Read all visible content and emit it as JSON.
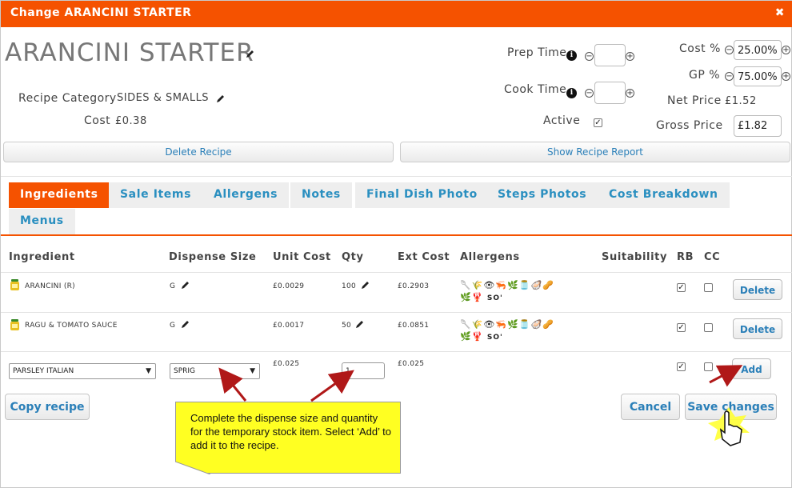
{
  "dialog": {
    "title": "Change ARANCINI STARTER",
    "close_glyph": "✖"
  },
  "recipe": {
    "name": "ARANCINI STARTER",
    "category_label": "Recipe Category",
    "category_value": "SIDES & SMALLS",
    "cost_label": "Cost",
    "cost_value": "£0.38"
  },
  "timing": {
    "prep_label": "Prep Time",
    "prep_value": "",
    "cook_label": "Cook Time",
    "cook_value": "",
    "active_label": "Active",
    "active_checked": true
  },
  "pricing": {
    "cost_pct_label": "Cost %",
    "cost_pct_value": "25.00%",
    "gp_pct_label": "GP %",
    "gp_pct_value": "75.00%",
    "net_price_label": "Net Price",
    "net_price_value": "£1.52",
    "gross_price_label": "Gross Price",
    "gross_price_value": "£1.82"
  },
  "actions": {
    "delete_recipe": "Delete Recipe",
    "show_report": "Show Recipe Report"
  },
  "tabs": [
    {
      "label": "Ingredients",
      "active": true
    },
    {
      "label": "Sale Items",
      "active": false
    },
    {
      "label": "Allergens",
      "active": false
    },
    {
      "label": "Notes",
      "active": false
    },
    {
      "label": "Final Dish Photo",
      "active": false
    },
    {
      "label": "Steps Photos",
      "active": false
    },
    {
      "label": "Cost Breakdown",
      "active": false
    },
    {
      "label": "Menus",
      "active": false
    }
  ],
  "table": {
    "headers": {
      "ingredient": "Ingredient",
      "dispense": "Dispense Size",
      "unit_cost": "Unit Cost",
      "qty": "Qty",
      "ext_cost": "Ext Cost",
      "allergens": "Allergens",
      "suitability": "Suitability",
      "rb": "RB",
      "cc": "CC"
    },
    "rows": [
      {
        "ingredient": "ARANCINI (R)",
        "dispense": "G",
        "unit_cost": "£0.0029",
        "qty": "100",
        "ext_cost": "£0.2903",
        "allergens_line1": "🥄🌾👁🦐🌿🫙🦪🥜",
        "allergens_line2": "🌿🦞",
        "allergens_so": "SO'",
        "rb": true,
        "cc": false,
        "action": "Delete"
      },
      {
        "ingredient": "RAGU & TOMATO SAUCE",
        "dispense": "G",
        "unit_cost": "£0.0017",
        "qty": "50",
        "ext_cost": "£0.0851",
        "allergens_line1": "🥄🌾👁🦐🌿🫙🦪🥜",
        "allergens_line2": "🌿🦞",
        "allergens_so": "SO'",
        "rb": true,
        "cc": false,
        "action": "Delete"
      }
    ],
    "new_row": {
      "ingredient_select": "PARSLEY ITALIAN",
      "dispense_select": "SPRIG",
      "unit_cost": "£0.025",
      "qty": "1",
      "ext_cost": "£0.025",
      "rb": true,
      "cc": false,
      "action": "Add"
    }
  },
  "footer": {
    "copy_recipe": "Copy recipe",
    "cancel": "Cancel",
    "save": "Save changes"
  },
  "callout": {
    "text": "Complete the dispense size and quantity for the temporary stock item. Select ‘Add’ to add it to the recipe."
  },
  "colors": {
    "brand_orange": "#f55200",
    "link_blue": "#2a7fb8",
    "callout_yellow": "#ffff22",
    "arrow_red": "#b01818"
  }
}
